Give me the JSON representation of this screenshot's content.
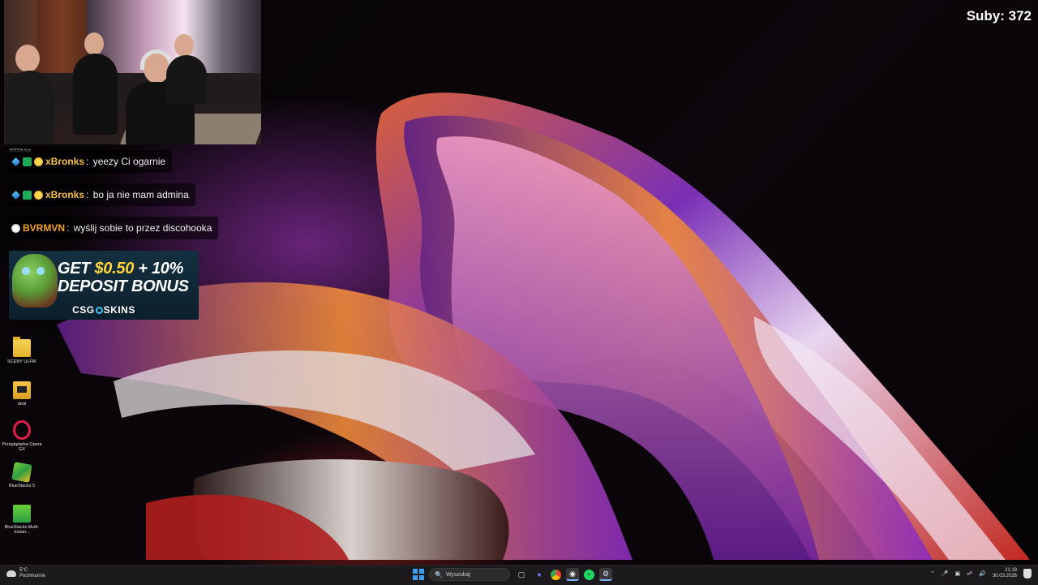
{
  "overlay": {
    "subs_label": "Suby: 372"
  },
  "webcam": {
    "watermark": "NVIDIA App"
  },
  "chat": {
    "messages": [
      {
        "user": "xBronks",
        "text": "yeezy Ci ogarnie",
        "badges": [
          "sword-badge",
          "sub-badge",
          "gold-badge"
        ]
      },
      {
        "user": "xBronks",
        "text": "bo ja nie mam admina",
        "badges": [
          "sword-badge",
          "sub-badge",
          "gold-badge"
        ]
      },
      {
        "user": "BVRMVN",
        "text": "wyślij sobie to przez discohooka",
        "badges": [
          "soccer-badge"
        ]
      }
    ]
  },
  "ad": {
    "line1_prefix": "GET",
    "line1_amount": "$0.50",
    "line1_suffix": "+ 10%",
    "line2": "DEPOSIT BONUS",
    "brand_left": "CSG",
    "brand_right": "SKINS"
  },
  "desktop_icons": [
    {
      "label": "SCENY ULFIK",
      "icon": "folder-icon"
    },
    {
      "label": "deal",
      "icon": "folder-icon"
    },
    {
      "label": "Przeglądarka Opera GX",
      "icon": "opera-gx-icon"
    },
    {
      "label": "BlueStacks 5",
      "icon": "bluestacks-icon"
    },
    {
      "label": "BlueStacks Multi-Instan...",
      "icon": "bluestacks-multi-icon"
    }
  ],
  "taskbar": {
    "weather_temp": "5°C",
    "weather_desc": "Pochmurnie",
    "search_placeholder": "Wyszukaj",
    "time": "21:19",
    "date": "30.03.2026"
  },
  "colors": {
    "username": "#f5c341",
    "accent_blue": "#3aa0f0",
    "taskbar_bg": "#1c1a1c"
  }
}
